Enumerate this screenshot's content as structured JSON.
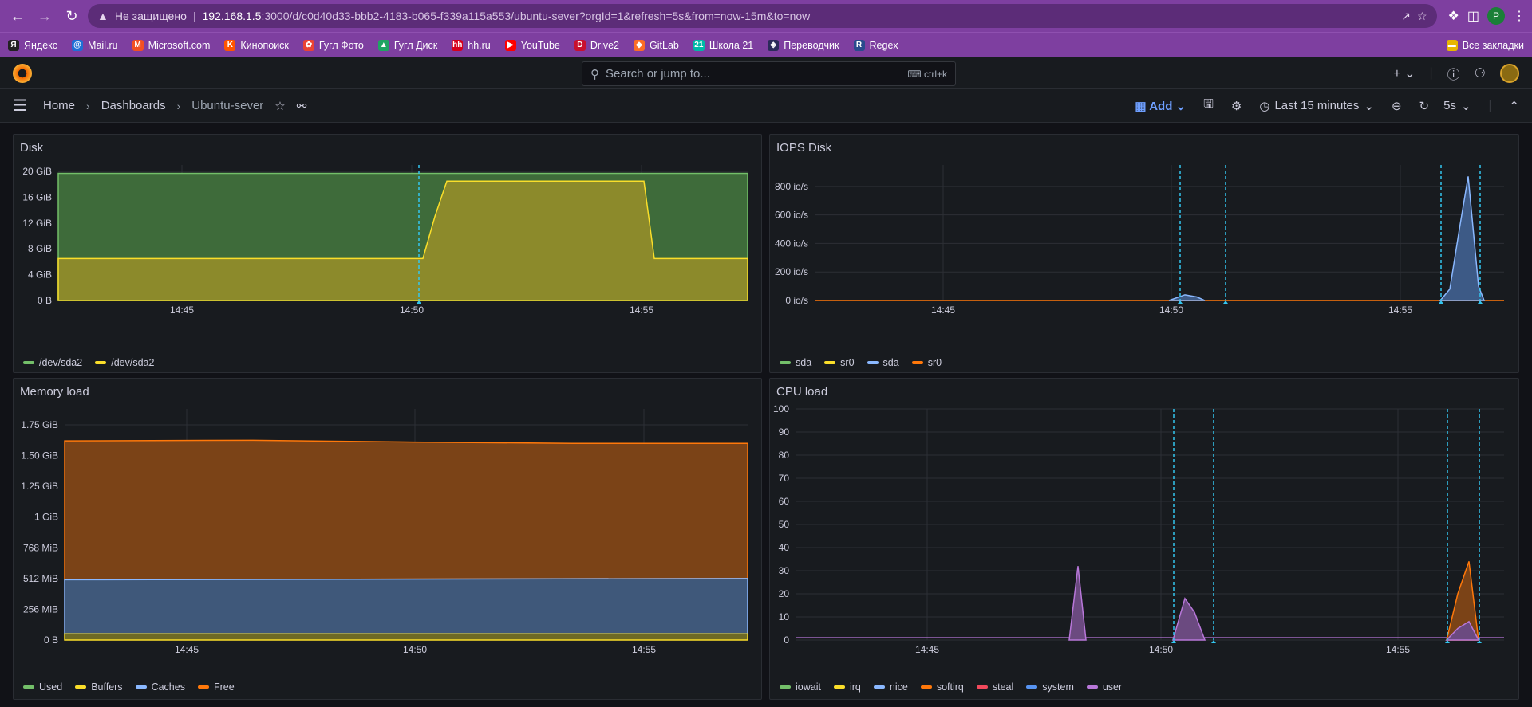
{
  "browser": {
    "security": "Не защищено",
    "host": "192.168.1.5",
    "path": ":3000/d/c0d40d33-bbb2-4183-b065-f339a115a553/ubuntu-sever?orgId=1&refresh=5s&from=now-15m&to=now",
    "profile_initial": "P"
  },
  "bookmarks": [
    {
      "label": "Яндекс",
      "color": "#222222",
      "glyph": "Я"
    },
    {
      "label": "Mail.ru",
      "color": "#1f6fd6",
      "glyph": "@"
    },
    {
      "label": "Microsoft.com",
      "color": "#f25022",
      "glyph": "M"
    },
    {
      "label": "Кинопоиск",
      "color": "#ff5500",
      "glyph": "K"
    },
    {
      "label": "Гугл Фото",
      "color": "#ea4335",
      "glyph": "✿"
    },
    {
      "label": "Гугл Диск",
      "color": "#1fa463",
      "glyph": "▲"
    },
    {
      "label": "hh.ru",
      "color": "#d6001c",
      "glyph": "hh"
    },
    {
      "label": "YouTube",
      "color": "#ff0000",
      "glyph": "▶"
    },
    {
      "label": "Drive2",
      "color": "#c8102e",
      "glyph": "D"
    },
    {
      "label": "GitLab",
      "color": "#fc6d26",
      "glyph": "◆"
    },
    {
      "label": "Школа 21",
      "color": "#00b9a7",
      "glyph": "21"
    },
    {
      "label": "Переводчик",
      "color": "#2b2b5a",
      "glyph": "◈"
    },
    {
      "label": "Regex",
      "color": "#2a4b8d",
      "glyph": "R"
    }
  ],
  "all_bookmarks": "Все закладки",
  "grafana": {
    "search_placeholder": "Search or jump to...",
    "search_shortcut": "ctrl+k",
    "breadcrumbs": [
      "Home",
      "Dashboards",
      "Ubuntu-sever"
    ],
    "add_label": "Add",
    "time_range": "Last 15 minutes",
    "refresh": "5s"
  },
  "x_ticks": [
    "14:45",
    "14:50",
    "14:55"
  ],
  "panels": {
    "disk": {
      "title": "Disk",
      "chart_data": {
        "type": "area",
        "x": [
          "14:41",
          "14:42",
          "14:43",
          "14:44",
          "14:45",
          "14:46",
          "14:47",
          "14:48",
          "14:49",
          "14:50",
          "14:50:30",
          "14:51",
          "14:52",
          "14:53",
          "14:54",
          "14:55",
          "14:55:30",
          "14:56",
          "14:57"
        ],
        "series": [
          {
            "name": "/dev/sda2",
            "color": "#73bf69",
            "values": [
              19.7,
              19.7,
              19.7,
              19.7,
              19.7,
              19.7,
              19.7,
              19.7,
              19.7,
              19.7,
              19.7,
              19.7,
              19.7,
              19.7,
              19.7,
              19.7,
              19.7,
              19.7,
              19.7
            ]
          },
          {
            "name": "/dev/sda2",
            "color": "#fade2a",
            "values": [
              6.5,
              6.5,
              6.5,
              6.5,
              6.5,
              6.5,
              6.5,
              6.5,
              6.5,
              6.5,
              14,
              18.5,
              18.5,
              18.5,
              18.5,
              18.5,
              6.5,
              6.5,
              6.5
            ]
          }
        ],
        "yticks": [
          "0 B",
          "4 GiB",
          "8 GiB",
          "12 GiB",
          "16 GiB",
          "20 GiB"
        ],
        "ylim": [
          0,
          21
        ]
      }
    },
    "iops": {
      "title": "IOPS Disk",
      "chart_data": {
        "type": "area",
        "series": [
          {
            "name": "sda",
            "color": "#73bf69"
          },
          {
            "name": "sr0",
            "color": "#fade2a"
          },
          {
            "name": "sda",
            "color": "#8ab8ff"
          },
          {
            "name": "sr0",
            "color": "#ff780a"
          }
        ],
        "peaks": [
          {
            "x": "14:50",
            "value": 40
          },
          {
            "x": "14:56",
            "value": 870
          }
        ],
        "yticks": [
          "0 io/s",
          "200 io/s",
          "400 io/s",
          "600 io/s",
          "800 io/s"
        ],
        "ylim": [
          0,
          950
        ]
      }
    },
    "memory": {
      "title": "Memory load",
      "chart_data": {
        "type": "area",
        "series": [
          {
            "name": "Used",
            "color": "#73bf69",
            "values_gib": 0.03
          },
          {
            "name": "Buffers",
            "color": "#fade2a",
            "values_gib": 0.04
          },
          {
            "name": "Caches",
            "color": "#8ab8ff",
            "values_gib": 0.43
          },
          {
            "name": "Free",
            "color": "#ff780a",
            "values_gib": 1.12
          }
        ],
        "yticks": [
          "0 B",
          "256 MiB",
          "512 MiB",
          "768 MiB",
          "1 GiB",
          "1.25 GiB",
          "1.50 GiB",
          "1.75 GiB"
        ],
        "ylim": [
          0,
          1.88
        ]
      }
    },
    "cpu": {
      "title": "CPU load",
      "chart_data": {
        "type": "area",
        "series": [
          {
            "name": "iowait",
            "color": "#73bf69"
          },
          {
            "name": "irq",
            "color": "#fade2a"
          },
          {
            "name": "nice",
            "color": "#8ab8ff"
          },
          {
            "name": "softirq",
            "color": "#ff780a"
          },
          {
            "name": "steal",
            "color": "#f2495c"
          },
          {
            "name": "system",
            "color": "#5794f2"
          },
          {
            "name": "user",
            "color": "#b877d9"
          }
        ],
        "peaks": [
          {
            "x": "14:48",
            "value": 32
          },
          {
            "x": "14:50",
            "value": 18
          },
          {
            "x": "14:56",
            "value": 34
          }
        ],
        "yticks": [
          "0",
          "10",
          "20",
          "30",
          "40",
          "50",
          "60",
          "70",
          "80",
          "90",
          "100"
        ],
        "ylim": [
          0,
          100
        ]
      }
    }
  }
}
